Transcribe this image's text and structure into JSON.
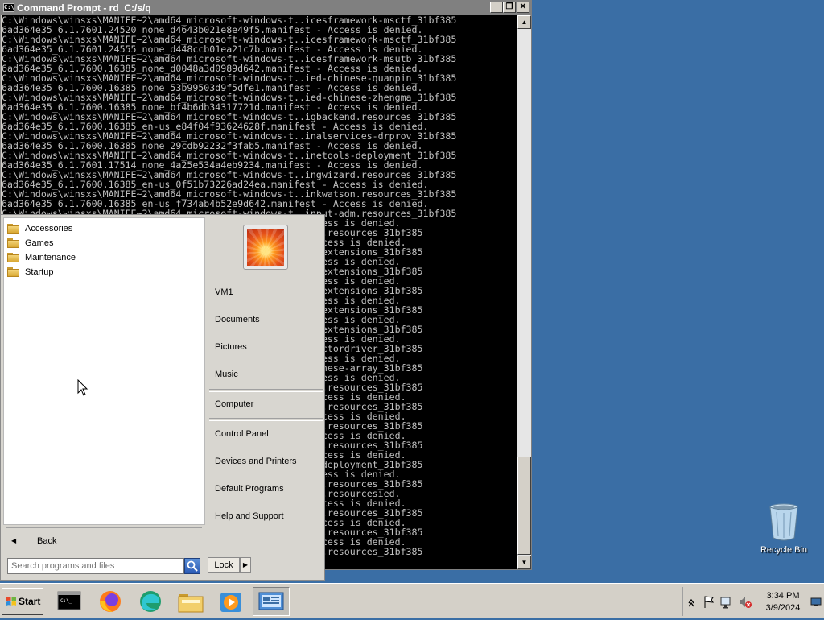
{
  "cmd": {
    "title": "Command Prompt - rd  C:/s/q",
    "buttons": {
      "minimize": "_",
      "restore": "❐",
      "close": "✕"
    },
    "lines": [
      "C:\\Windows\\winsxs\\MANIFE~2\\amd64_microsoft-windows-t..icesframework-msctf_31bf385",
      "6ad364e35_6.1.7601.24520_none_d4643b021e8e49f5.manifest - Access is denied.",
      "C:\\Windows\\winsxs\\MANIFE~2\\amd64_microsoft-windows-t..icesframework-msctf_31bf385",
      "6ad364e35_6.1.7601.24555_none_d448ccb01ea21c7b.manifest - Access is denied.",
      "C:\\Windows\\winsxs\\MANIFE~2\\amd64_microsoft-windows-t..icesframework-msutb_31bf385",
      "6ad364e35_6.1.7600.16385_none_d0048a3d0989d642.manifest - Access is denied.",
      "C:\\Windows\\winsxs\\MANIFE~2\\amd64_microsoft-windows-t..ied-chinese-quanpin_31bf385",
      "6ad364e35_6.1.7600.16385_none_53b99503d9f5dfe1.manifest - Access is denied.",
      "C:\\Windows\\winsxs\\MANIFE~2\\amd64_microsoft-windows-t..ied-chinese-zhengma_31bf385",
      "6ad364e35_6.1.7600.16385_none_bf4b6db34317721d.manifest - Access is denied.",
      "C:\\Windows\\winsxs\\MANIFE~2\\amd64_microsoft-windows-t..igbackend.resources_31bf385",
      "6ad364e35_6.1.7600.16385_en-us_e84f04f93624628f.manifest - Access is denied.",
      "C:\\Windows\\winsxs\\MANIFE~2\\amd64_microsoft-windows-t..inalservices-drprov_31bf385",
      "6ad364e35_6.1.7600.16385_none_29cdb92232f3fab5.manifest - Access is denied.",
      "C:\\Windows\\winsxs\\MANIFE~2\\amd64_microsoft-windows-t..inetools-deployment_31bf385",
      "6ad364e35_6.1.7601.17514_none_4a25e534a4eb9234.manifest - Access is denied.",
      "C:\\Windows\\winsxs\\MANIFE~2\\amd64_microsoft-windows-t..ingwizard.resources_31bf385",
      "6ad364e35_6.1.7600.16385_en-us_0f51b73226ad24ea.manifest - Access is denied.",
      "C:\\Windows\\winsxs\\MANIFE~2\\amd64_microsoft-windows-t..inkwatson.resources_31bf385",
      "6ad364e35_6.1.7600.16385_en-us_f734ab4b52e9d642.manifest - Access is denied.",
      "C:\\Windows\\winsxs\\MANIFE~2\\amd64_microsoft-windows-t..input-adm.resources_31bf385",
      "                                              ifest - Access is denied.",
      "                                              ..installer.resources_31bf385",
      "                                              nifest - Access is denied.",
      "                                              ..instationextensions_31bf385",
      "                                              ifest - Access is denied.",
      "                                              ..instationextensions_31bf385",
      "                                              ifest - Access is denied.",
      "                                              ..instationextensions_31bf385",
      "                                              ifest - Access is denied.",
      "                                              ..instationextensions_31bf385",
      "                                              ifest - Access is denied.",
      "                                              ..instationextensions_31bf385",
      "                                              ifest - Access is denied.",
      "                                              ..ion-reflectordriver_31bf385",
      "                                              ifest - Access is denied.",
      "                                              ..ional-chinese-array_31bf385",
      "                                              ifest - Access is denied.",
      "                                              ..iondriver.resources_31bf385",
      "                                              nifest - Access is denied.",
      "                                              ..ionplugin.resources_31bf385",
      "                                              nifest - Access is denied.",
      "                                              ..iprovider.resources_31bf385",
      "                                              nifest - Access is denied.",
      "                                              ..iprovider.resources_31bf385",
      "                                              nifest - Access is denied.",
      "                                              ..irection-deployment_31bf385",
      "                                              ifest - Access is denied.",
      "                                              ..k-msctfui.resources_31bf385",
      "                                              ..langu Aes.resourcesied.",
      "                                              nifest - Access is denied.",
      "                                              ..languages.resources_31bf385",
      "                                              nifest - Access is denied.",
      "                                              ..languages.resources_31bf385",
      "                                              nifest - Access is denied.",
      "                                              ..languages.resources_31bf385"
    ]
  },
  "start_menu": {
    "programs": [
      "Accessories",
      "Games",
      "Maintenance",
      "Startup"
    ],
    "back_label": "Back",
    "search_placeholder": "Search programs and files",
    "right_items": {
      "user": "VM1",
      "documents": "Documents",
      "pictures": "Pictures",
      "music": "Music",
      "computer": "Computer",
      "control_panel": "Control Panel",
      "devices": "Devices and Printers",
      "defaults": "Default Programs",
      "help": "Help and Support"
    },
    "lock_label": "Lock",
    "lock_arrow": "▶"
  },
  "desktop": {
    "recycle_bin": "Recycle Bin"
  },
  "taskbar": {
    "start_label": "Start",
    "pinned": [
      "command-prompt",
      "firefox",
      "edge",
      "windows-explorer",
      "media-player",
      "remote-desktop"
    ],
    "clock_time": "3:34 PM",
    "clock_date": "3/9/2024"
  }
}
